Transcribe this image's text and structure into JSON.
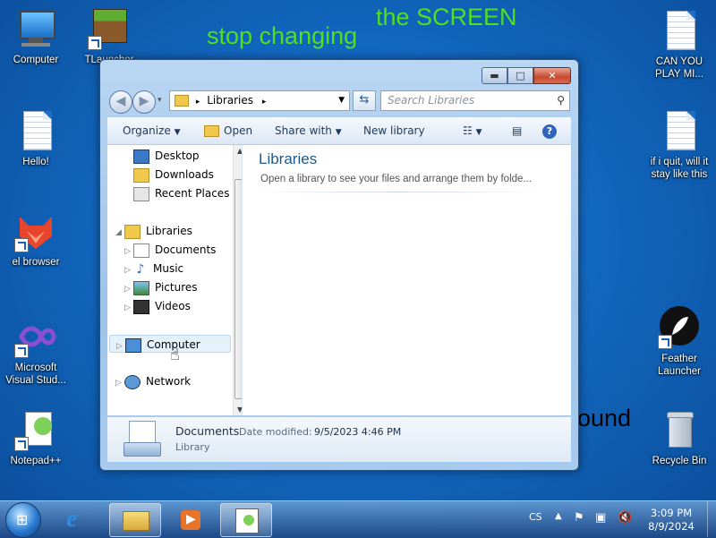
{
  "desktop": {
    "wordart_top": "the SCREEN",
    "wordart_mid": "stop changing",
    "hidden_text": "ound",
    "icons": [
      {
        "label": "Computer"
      },
      {
        "label": "TLauncher"
      },
      {
        "label": "Hello!"
      },
      {
        "label": "el browser"
      },
      {
        "label": "Microsoft Visual Stud..."
      },
      {
        "label": "Notepad++"
      },
      {
        "label": "CAN YOU PLAY MI..."
      },
      {
        "label": "if i quit, will it stay like this"
      },
      {
        "label": "Feather Launcher"
      },
      {
        "label": "Recycle Bin"
      }
    ]
  },
  "window": {
    "address": "Libraries",
    "search_placeholder": "Search Libraries",
    "toolbar": {
      "organize": "Organize",
      "open": "Open",
      "share": "Share with",
      "new_library": "New library"
    },
    "nav": {
      "desktop": "Desktop",
      "downloads": "Downloads",
      "recent": "Recent Places",
      "libraries": "Libraries",
      "documents": "Documents",
      "music": "Music",
      "pictures": "Pictures",
      "videos": "Videos",
      "computer": "Computer",
      "network": "Network"
    },
    "content": {
      "title": "Libraries",
      "subtitle": "Open a library to see your files and arrange them by folde..."
    },
    "details": {
      "name": "Documents",
      "date_label": "Date modified:",
      "date_value": "9/5/2023 4:46 PM",
      "type": "Library"
    }
  },
  "taskbar": {
    "lang": "CS",
    "time": "3:09 PM",
    "date": "8/9/2024"
  },
  "colors": {
    "wordart": "#4fe020",
    "desktop_bg": "#1a73c9",
    "title_accent": "#1e5a8a"
  }
}
